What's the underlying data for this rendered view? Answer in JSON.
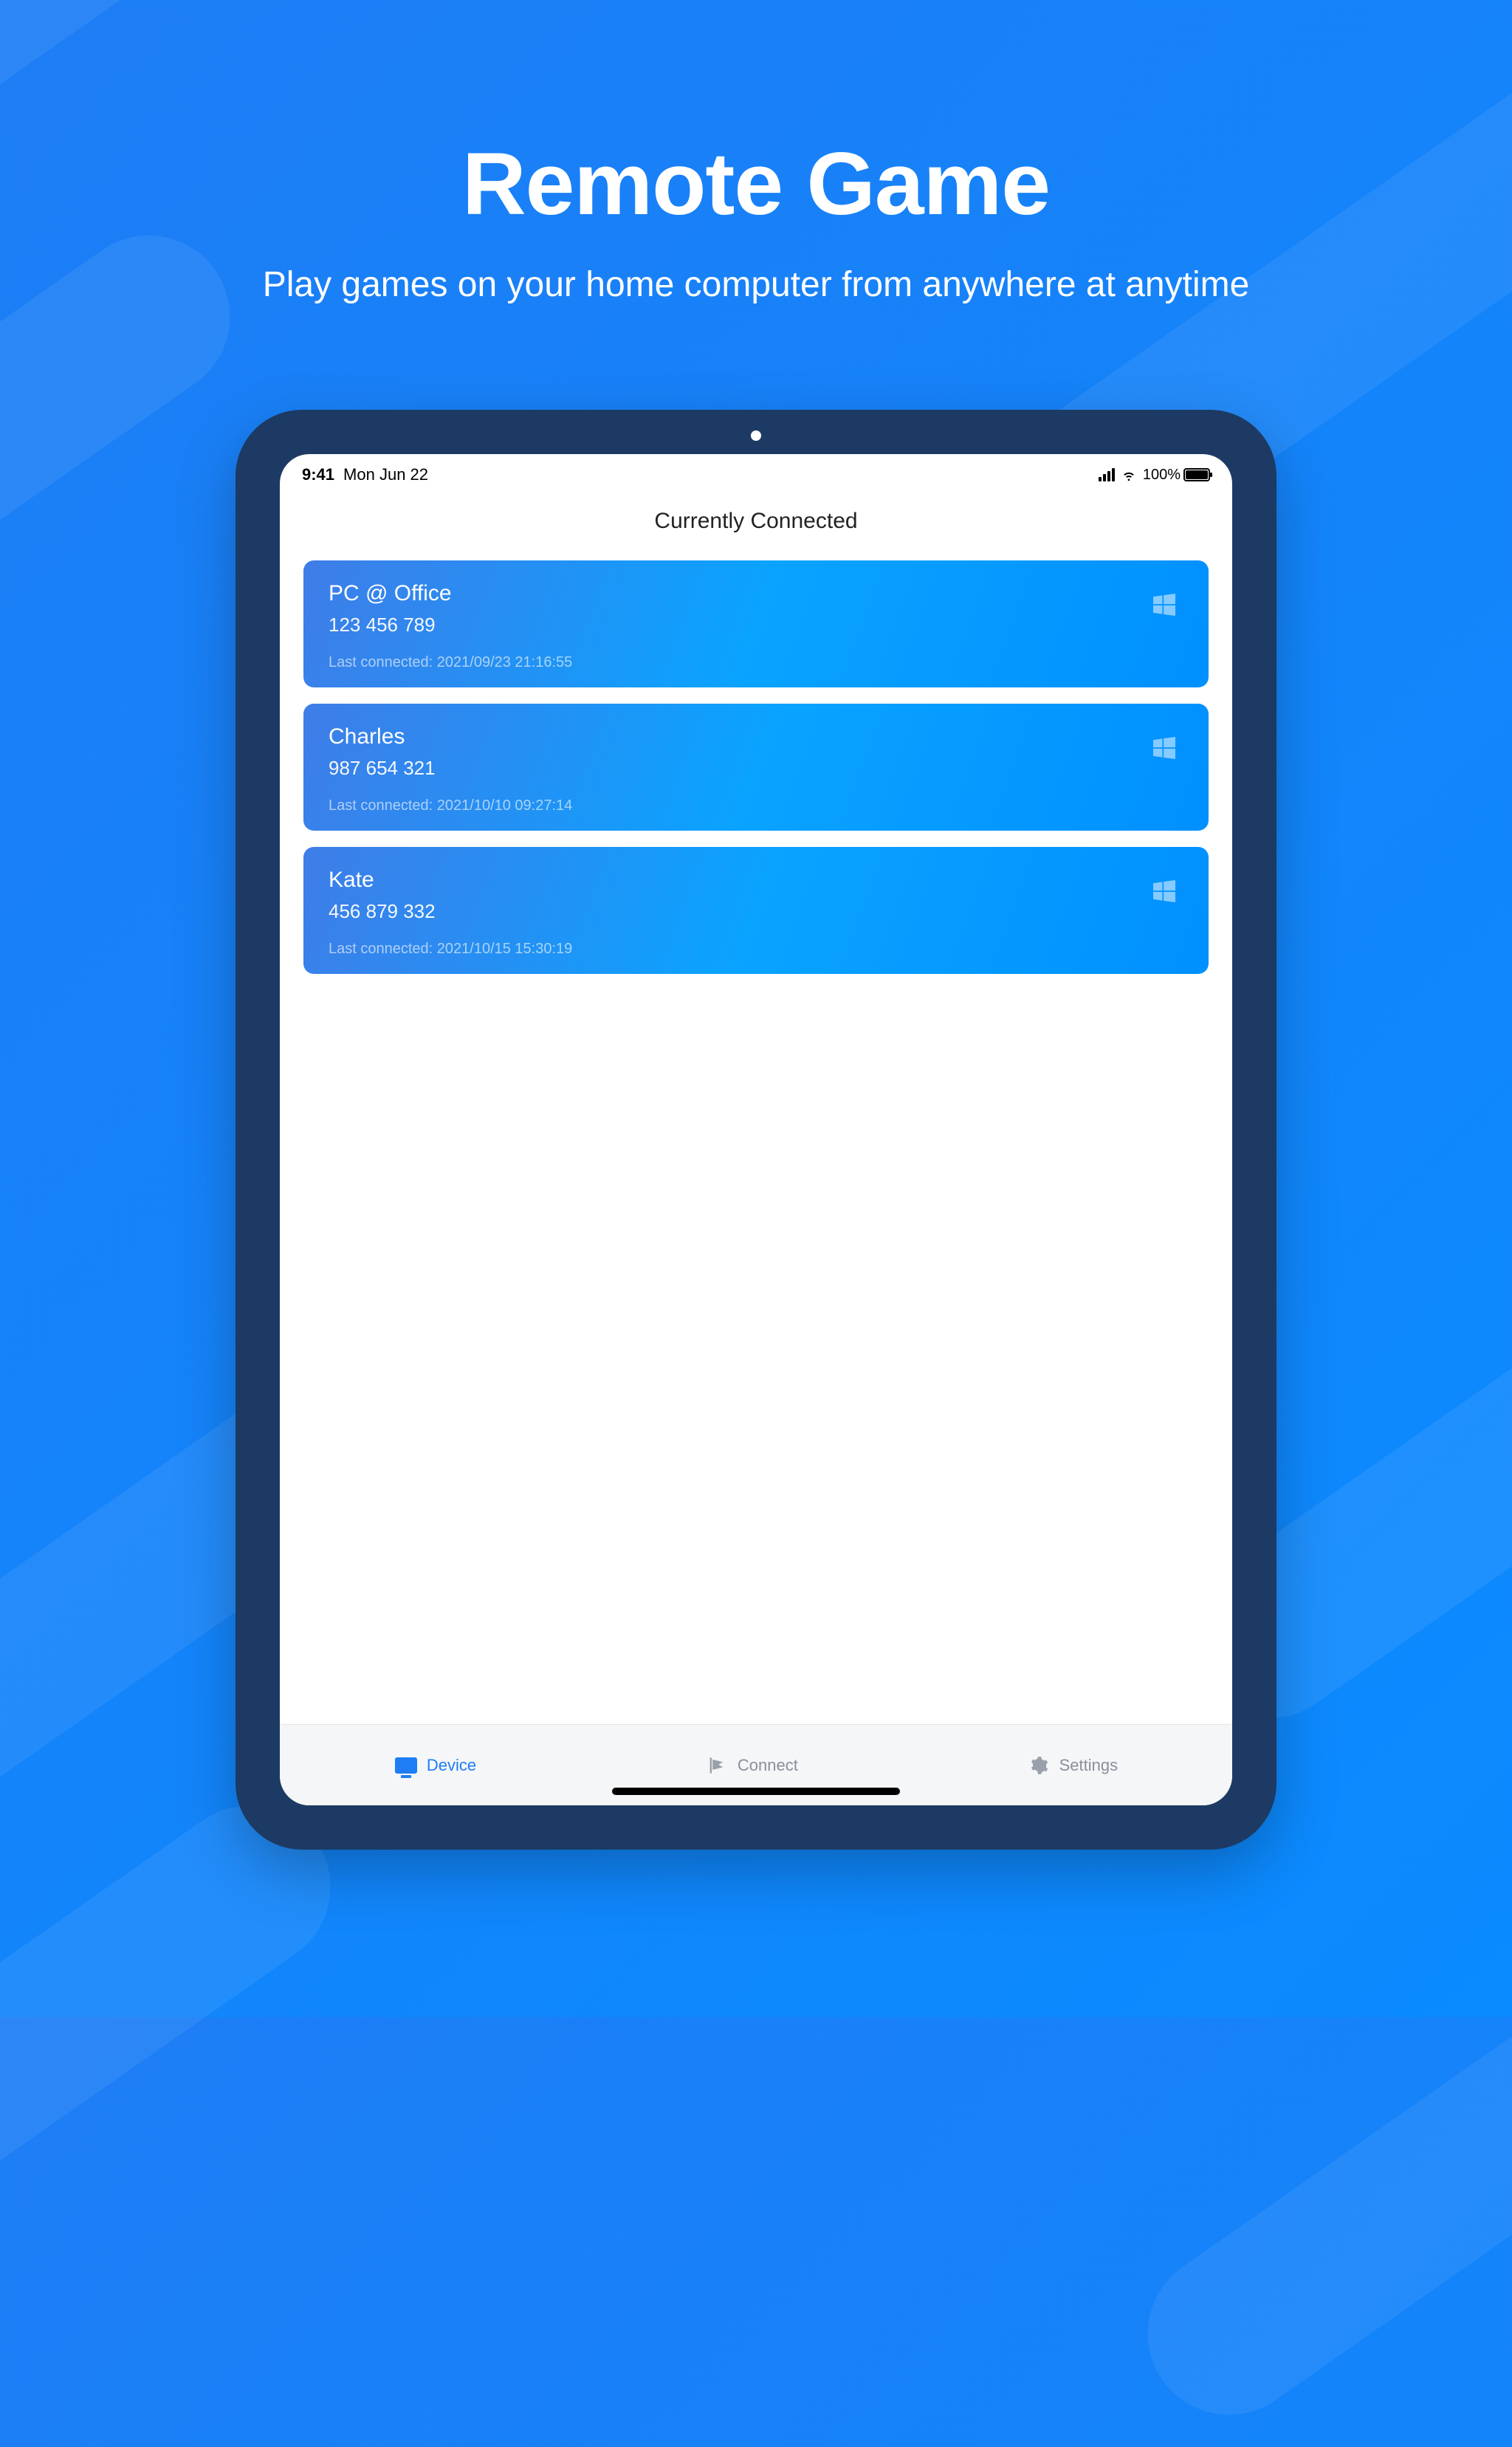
{
  "hero": {
    "title": "Remote Game",
    "subtitle": "Play games on your home computer from anywhere at anytime"
  },
  "status_bar": {
    "time": "9:41",
    "date": "Mon Jun 22",
    "battery_pct": "100%"
  },
  "page": {
    "title": "Currently Connected",
    "last_connected_label": "Last connected:"
  },
  "devices": [
    {
      "name": "PC @ Office",
      "id": "123 456 789",
      "last": "2021/09/23  21:16:55",
      "os": "windows"
    },
    {
      "name": "Charles",
      "id": "987 654 321",
      "last": "2021/10/10  09:27:14",
      "os": "windows"
    },
    {
      "name": "Kate",
      "id": "456 879 332",
      "last": "2021/10/15  15:30:19",
      "os": "windows"
    }
  ],
  "tabs": {
    "device": "Device",
    "connect": "Connect",
    "settings": "Settings"
  }
}
